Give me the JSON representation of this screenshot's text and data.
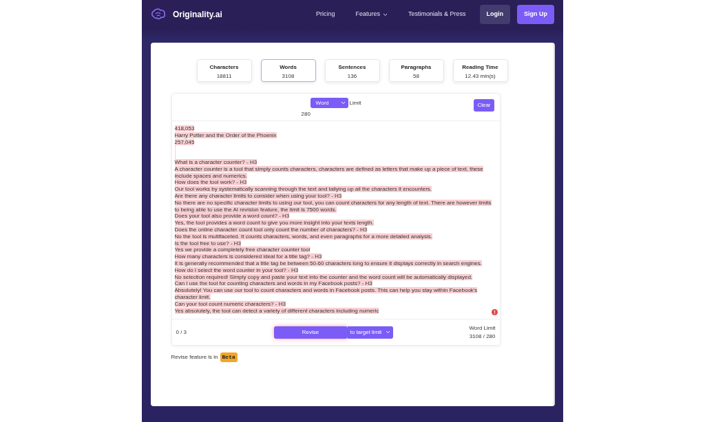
{
  "navbar": {
    "brand": "Originality.ai",
    "links": [
      {
        "label": "Pricing",
        "dropdown": false
      },
      {
        "label": "Features",
        "dropdown": true
      },
      {
        "label": "Testimonials & Press",
        "dropdown": false
      }
    ],
    "login": "Login",
    "signup": "Sign Up"
  },
  "stats": [
    {
      "label": "Characters",
      "value": "18811",
      "selected": false
    },
    {
      "label": "Words",
      "value": "3108",
      "selected": true
    },
    {
      "label": "Sentences",
      "value": "136",
      "selected": false
    },
    {
      "label": "Paragraphs",
      "value": "58",
      "selected": false
    },
    {
      "label": "Reading Time",
      "value": "12.43 min(s)",
      "selected": false
    }
  ],
  "toolbar": {
    "mode": "Word",
    "limit_label": "Limit",
    "limit_value": "280",
    "clear": "Clear"
  },
  "editor": {
    "lines": [
      {
        "kind": "line",
        "text": "418,053"
      },
      {
        "kind": "line",
        "text": "Harry Potter and the Order of the Phoenix"
      },
      {
        "kind": "line",
        "text": "257,045"
      },
      {
        "kind": "blank"
      },
      {
        "kind": "blank"
      },
      {
        "kind": "line",
        "text": "What is a character counter? - H3"
      },
      {
        "kind": "line",
        "text": "A character counter is a tool that simply counts characters, characters are defined as letters that make up a piece of text, these"
      },
      {
        "kind": "line",
        "text": "include spaces and numerics."
      },
      {
        "kind": "line",
        "text": "How does the tool work? - H3"
      },
      {
        "kind": "line",
        "text": "Our tool works by systematically scanning through the text and tallying up all the characters it encounters."
      },
      {
        "kind": "line",
        "text": "Are there any character limits to consider when using your tool? - H3"
      },
      {
        "kind": "line",
        "text": "No there are no specific character limits to using our tool, you can count characters for any length of text. There are however limits"
      },
      {
        "kind": "line",
        "text": "to being able to use the AI revision feature, the limit is 7500 words."
      },
      {
        "kind": "line",
        "text": "Does your tool also provide a word count? - H3"
      },
      {
        "kind": "line",
        "text": "Yes, the tool provides a word count to give you more insight into your texts length."
      },
      {
        "kind": "line",
        "text": "Does the online character count tool only count the number of characters? - H3"
      },
      {
        "kind": "line",
        "text": "No the tool is multifaceted. It counts characters, words, and even paragraphs for a more detailed analysis."
      },
      {
        "kind": "line",
        "text": "Is the tool free to use? - H3"
      },
      {
        "kind": "line",
        "text": "Yes we provide a completely free character counter tool"
      },
      {
        "kind": "line",
        "text": "How many characters is considered ideal for a title tag? - H3"
      },
      {
        "kind": "line",
        "text": "It is generally recommended that a title tag be between 50-60 characters long to ensure it displays correctly in search engines."
      },
      {
        "kind": "line",
        "text": "How do I select the word counter in your tool? - H3"
      },
      {
        "kind": "line",
        "text": "No selection required! Simply copy and paste your text into the counter and the word count will be automatically displayed."
      },
      {
        "kind": "line",
        "text": "Can I use the tool for counting characters and words in my Facebook posts? - H3"
      },
      {
        "kind": "line",
        "text": "Absolutely! You can use our tool to count characters and words in Facebook posts. This can help you stay within Facebook's"
      },
      {
        "kind": "line",
        "text": "character limit."
      },
      {
        "kind": "line",
        "text": "Can your tool count numeric characters? - H3"
      },
      {
        "kind": "line",
        "text": "Yes absolutely, the tool can detect a variety of different characters including numeric"
      }
    ]
  },
  "footer": {
    "counter": "0 / 3",
    "revise": "Revise",
    "target": "to target limit",
    "limit_label": "Word Limit",
    "limit_value": "3108 / 280"
  },
  "beta_note": {
    "text": "Revise feature is in",
    "badge": "Beta"
  }
}
